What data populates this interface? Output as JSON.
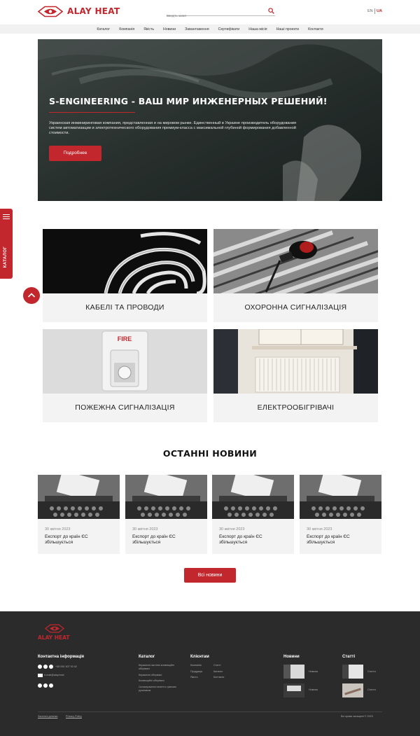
{
  "header": {
    "brand": "ALAY HEAT",
    "search_placeholder": "Введіть запит",
    "lang_en": "EN",
    "lang_ua": "UA"
  },
  "nav": [
    "Каталог",
    "Компанія",
    "Якість",
    "Новини",
    "Завантаження",
    "Сертифікати",
    "Наша місія",
    "Наші проекти",
    "Контакти"
  ],
  "hero": {
    "title": "S-ENGINEERING - ВАШ МИР ИНЖЕНЕРНЫХ РЕШЕНИЙ!",
    "text": "Украинская инжиниринговая компания, представленная и на мировом рынке. Единственный в Украине производитель оборудования систем автоматизации и электротехнического оборудования премиум-класса с максимальной глубиной формирования добавленной стоимости.",
    "button": "Подробнее"
  },
  "side_tab": "КАТАЛОГ",
  "categories": [
    "КАБЕЛІ ТА ПРОВОДИ",
    "ОХОРОННА СИГНАЛІЗАЦІЯ",
    "ПОЖЕЖНА СИГНАЛІЗАЦІЯ",
    "ЕЛЕКТРООБІГРІВАЧІ"
  ],
  "fire_label": "FIRE",
  "news_section": {
    "title": "ОСТАННІ НОВИНИ",
    "items": [
      {
        "date": "30 квітня 2023",
        "title": "Експорт до країн ЄС збільшується"
      },
      {
        "date": "30 квітня 2023",
        "title": "Експорт до країн ЄС збільшується"
      },
      {
        "date": "30 квітня 2023",
        "title": "Експорт до країн ЄС збільшується"
      },
      {
        "date": "30 квітня 2023",
        "title": "Експорт до країн ЄС збільшується"
      }
    ],
    "all_button": "Всі новини"
  },
  "footer": {
    "brand": "ALAY HEAT",
    "contact_title": "Контактна інформація",
    "phone": "+38 050 307 00 02",
    "email": "e-mail@alay.heat",
    "catalog_title": "Каталог",
    "catalog_links": [
      "Керамічні настінні конвекційні обігрівачі",
      "Керамічні обігрівачі",
      "Конвекційні обігрівачі",
      "Склокерамічні панелі з гріючим рушником"
    ],
    "clients_title": "Клієнтам",
    "clients_col1": [
      "Компанія",
      "Продукція",
      "Якість"
    ],
    "clients_col2": [
      "Статті",
      "Каталог",
      "Контакти"
    ],
    "news_title": "Новини",
    "news_links": [
      "Новина",
      "Новина"
    ],
    "articles_title": "Статті",
    "articles_links": [
      "Стаття",
      "Стаття"
    ],
    "bottom_left1": "Загальні ділянки",
    "bottom_left2": "Privacy Policy",
    "copyright": "Всі права захищені © 2023"
  },
  "colors": {
    "accent": "#c1272d",
    "footer_bg": "#2b2b2b",
    "nav_bg": "#f1f1f1",
    "card_bg": "#f3f3f3"
  }
}
